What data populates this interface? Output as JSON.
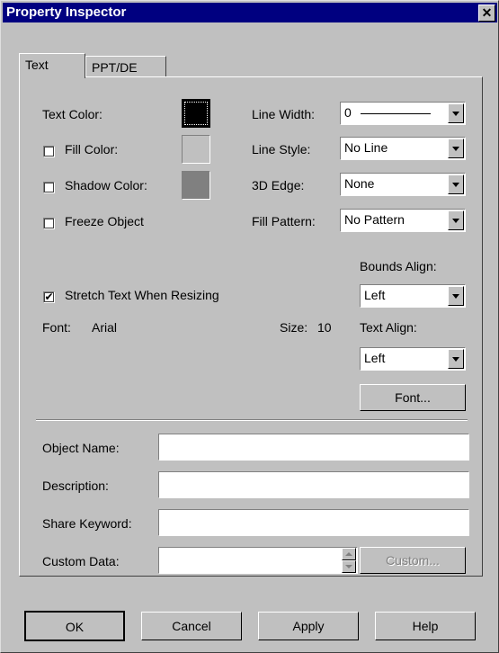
{
  "window": {
    "title": "Property Inspector",
    "close_glyph": "✕"
  },
  "tabs": [
    {
      "label": "Text"
    },
    {
      "label": "PPT/DE"
    }
  ],
  "colors": {
    "text_color": "#000000",
    "fill_color": "#c0c0c0",
    "shadow_color": "#808080"
  },
  "left": {
    "text_color_label": "Text Color:",
    "fill_color_label": "Fill Color:",
    "shadow_color_label": "Shadow Color:",
    "freeze_label": "Freeze Object",
    "stretch_label": "Stretch Text When Resizing"
  },
  "checks": {
    "fill_color": false,
    "shadow_color": false,
    "freeze_object": false,
    "stretch_text": true,
    "check_glyph": "✔"
  },
  "right": {
    "line_width_label": "Line Width:",
    "line_width_value": "0",
    "line_style_label": "Line Style:",
    "line_style_value": "No Line",
    "edge_label": "3D Edge:",
    "edge_value": "None",
    "fill_pattern_label": "Fill Pattern:",
    "fill_pattern_value": "No Pattern",
    "bounds_align_label": "Bounds Align:",
    "bounds_align_value": "Left",
    "text_align_label": "Text Align:",
    "text_align_value": "Left",
    "font_button": "Font..."
  },
  "font": {
    "label": "Font:",
    "name": "Arial",
    "size_label": "Size:",
    "size": "10"
  },
  "fields": {
    "object_name_label": "Object Name:",
    "object_name_value": "",
    "description_label": "Description:",
    "description_value": "",
    "share_keyword_label": "Share Keyword:",
    "share_keyword_value": "",
    "custom_data_label": "Custom Data:",
    "custom_data_value": "",
    "custom_button": "Custom..."
  },
  "buttons": {
    "ok": "OK",
    "cancel": "Cancel",
    "apply": "Apply",
    "help": "Help"
  }
}
